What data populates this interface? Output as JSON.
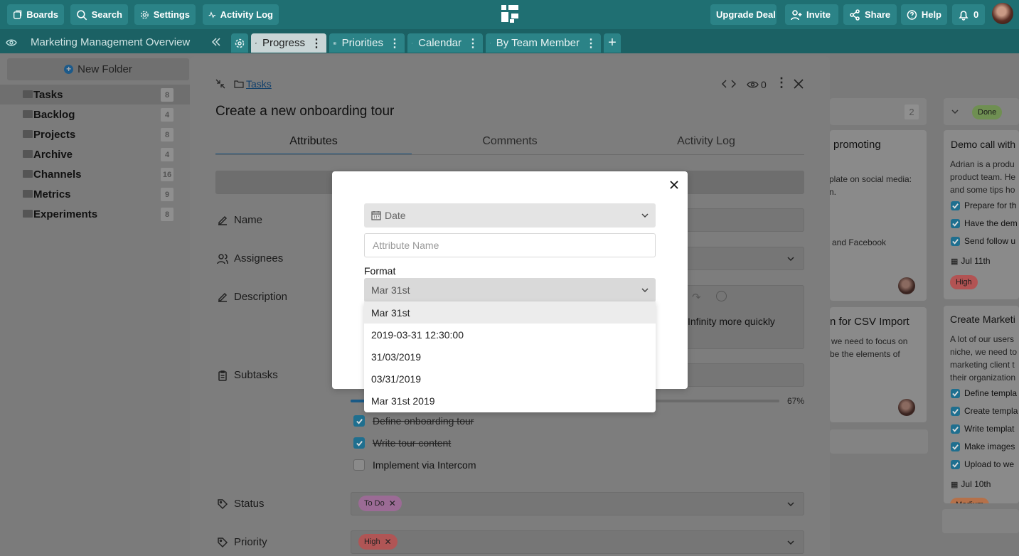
{
  "topbar": {
    "boards": "Boards",
    "search": "Search",
    "settings": "Settings",
    "activity_log": "Activity Log",
    "upgrade": "Upgrade Deal",
    "invite": "Invite",
    "share": "Share",
    "help": "Help",
    "notifications": "0"
  },
  "tabs": {
    "workspace": "Marketing Management Overview",
    "items": [
      "Progress",
      "Priorities",
      "Calendar",
      "By Team Member"
    ]
  },
  "sidebar": {
    "new_folder": "New Folder",
    "folders": [
      {
        "name": "Tasks",
        "count": "8"
      },
      {
        "name": "Backlog",
        "count": "4"
      },
      {
        "name": "Projects",
        "count": "8"
      },
      {
        "name": "Archive",
        "count": "4"
      },
      {
        "name": "Channels",
        "count": "16"
      },
      {
        "name": "Metrics",
        "count": "9"
      },
      {
        "name": "Experiments",
        "count": "8"
      }
    ]
  },
  "board": {
    "col_count": "2",
    "card1_title": "promoting",
    "card1_text1": "plate on social media:",
    "card1_text2": "n.",
    "card1_text3": "and Facebook",
    "card2_title": "n for CSV Import",
    "card2_text1": "we need to focus on",
    "card2_text2": "be the elements of",
    "done_label": "Done",
    "card3_title": "Demo call with",
    "card3_text": [
      "Adrian is a produ",
      "product team. He",
      "and some tips ho"
    ],
    "card3_checks": [
      "Prepare for th",
      "Have the dem",
      "Send follow u"
    ],
    "card3_date": "Jul 11th",
    "card3_priority": "High",
    "card4_title": "Create Marketi",
    "card4_text": [
      "A lot of our users",
      "niche, we need to",
      "marketing client t",
      "their organization"
    ],
    "card4_checks": [
      "Define templa",
      "Create templa",
      "Write templat",
      "Make images",
      "Upload to we"
    ],
    "card4_date": "Jul 10th",
    "card4_priority": "Medium"
  },
  "panel": {
    "breadcrumb": "Tasks",
    "watchers": "0",
    "title": "Create a new onboarding tour",
    "tabs": [
      "Attributes",
      "Comments",
      "Activity Log"
    ],
    "labels": {
      "name": "Name",
      "assignees": "Assignees",
      "description": "Description",
      "subtasks": "Subtasks",
      "status": "Status",
      "priority": "Priority"
    },
    "description_text": "Infinity more quickly",
    "progress": 67,
    "progress_label": "67%",
    "subtasks": [
      {
        "text": "Define onboarding tour",
        "done": true
      },
      {
        "text": "Write tour content",
        "done": true
      },
      {
        "text": "Implement via Intercom",
        "done": false
      }
    ],
    "status_tag": "To Do",
    "priority_tag": "High"
  },
  "modal": {
    "type_value": "Date",
    "name_placeholder": "Attribute Name",
    "format_label": "Format",
    "format_value": "Mar 31st",
    "options": [
      "Mar 31st",
      "2019-03-31 12:30:00",
      "31/03/2019",
      "03/31/2019",
      "Mar 31st 2019"
    ]
  },
  "colors": {
    "teal": "#2b8387",
    "status_todo": "#e3a4d8",
    "priority_high": "#e87c7c",
    "priority_medium": "#e8a070",
    "done_green": "#9ccc65",
    "progress_blue": "#1f77b4"
  }
}
